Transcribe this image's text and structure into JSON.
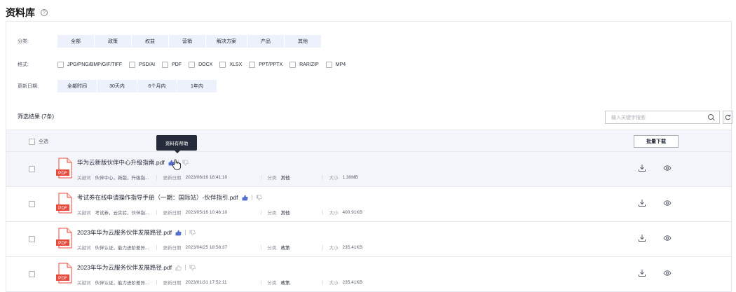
{
  "page": {
    "title": "资料库",
    "help_icon": "help-circle-icon"
  },
  "filters": {
    "category": {
      "label": "分类:",
      "options": [
        "全部",
        "政策",
        "权益",
        "营销",
        "解决方案",
        "产品",
        "其他"
      ]
    },
    "format": {
      "label": "格式:",
      "options": [
        "JPG/PNG/BMP/GIF/TIFF",
        "PSD/AI",
        "PDF",
        "DOCX",
        "XLSX",
        "PPT/PPTX",
        "RAR/ZIP",
        "MP4"
      ]
    },
    "date": {
      "label": "更新日期:",
      "options": [
        "全部时间",
        "30天内",
        "6个月内",
        "1年内"
      ]
    }
  },
  "results": {
    "label": "筛选结果 (7条)",
    "search_placeholder": "输入关键字搜索",
    "refresh_icon": "refresh-icon"
  },
  "table": {
    "select_all": "全选",
    "batch_download": "批量下载",
    "meta_labels": {
      "keywords": "关键词",
      "updated": "更新日期",
      "category": "分类",
      "size": "大小"
    },
    "rows": [
      {
        "title": "华为云新版伙伴中心升级指南.pdf",
        "keywords": "伙伴中心，新版，升级指...",
        "updated": "2023/06/16 18:41:10",
        "category": "其他",
        "size": "1.30MB",
        "liked": true
      },
      {
        "title": "考试券在线申请操作指导手册（一期：国际站）-伙伴指引.pdf",
        "keywords": "考试券，云实验，伙伴指...",
        "updated": "2023/05/16 10:46:10",
        "category": "其他",
        "size": "400.91KB",
        "liked": true
      },
      {
        "title": "2023年华为云服务伙伴发展路径.pdf",
        "keywords": "伙伴认证，能力进阶差异...",
        "updated": "2023/04/25 18:58:37",
        "category": "政策",
        "size": "235.41KB",
        "liked": true
      },
      {
        "title": "2023年华为云服务伙伴发展路径.pdf",
        "keywords": "伙伴认证，能力进阶差异...",
        "updated": "2023/01/31 17:52:11",
        "category": "政策",
        "size": "235.41KB",
        "liked": false
      }
    ]
  },
  "tooltip": {
    "text": "资料有帮助"
  },
  "icon_label": "PDF",
  "colors": {
    "accent": "#526ecc",
    "pdf_red": "#e84b3c",
    "chip_bg": "#edf1fb",
    "row_hover": "#f3f5fa"
  }
}
